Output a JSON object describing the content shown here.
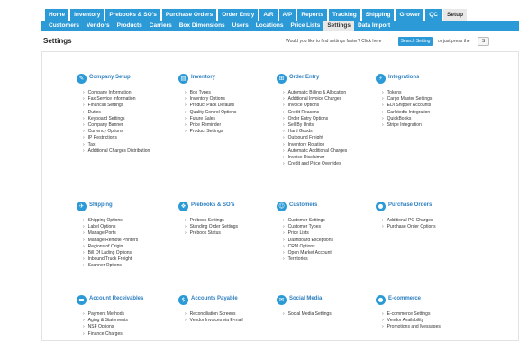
{
  "main_tabs": [
    "Home",
    "Inventory",
    "Prebooks & SO's",
    "Purchase Orders",
    "Order Entry",
    "A/R",
    "A/P",
    "Reports",
    "Tracking",
    "Shipping",
    "Grower",
    "QC",
    "Setup"
  ],
  "active_main_tab": "Setup",
  "sub_tabs": [
    "Customers",
    "Vendors",
    "Products",
    "Carriers",
    "Box Dimensions",
    "Users",
    "Locations",
    "Price Lists",
    "Settings",
    "Data Import"
  ],
  "active_sub_tab": "Settings",
  "header": {
    "title": "Settings",
    "hint": "Would you like to find settings faster? Click here",
    "search_button": "Search Setting",
    "hint2": "or just press the",
    "key": "S"
  },
  "sections": [
    {
      "title": "Company Setup",
      "icon": "wrench-icon",
      "items": [
        "Company Information",
        "Fax Service Information",
        "Financial Settings",
        "Duties",
        "Keyboard Settings",
        "Company Banner",
        "Currency Options",
        "IP Restrictions",
        "Tax",
        "Additional Charges Distribution"
      ]
    },
    {
      "title": "Inventory",
      "icon": "inventory-icon",
      "items": [
        "Box Types",
        "Inventory Options",
        "Product Pack Defaults",
        "Quality Control Options",
        "Future Sales",
        "Price Reminder",
        "Product Settings"
      ]
    },
    {
      "title": "Order Entry",
      "icon": "cart-icon",
      "items": [
        "Automatic Billing & Allocation",
        "Additional Invoice Charges",
        "Invoice Options",
        "Credit Reasons",
        "Order Entry Options",
        "Sell By Units",
        "Hard Goods",
        "Outbound Freight",
        "Inventory Rotation",
        "Automatic Additional Charges",
        "Invoice Disclaimer",
        "Credit and Price Overrides"
      ]
    },
    {
      "title": "Integrations",
      "icon": "plug-icon",
      "items": [
        "Tokens",
        "Cargo Master Settings",
        "EDI Shipper Accounts",
        "Carlstedts Integration",
        "QuickBooks",
        "Stripe Integration"
      ]
    },
    {
      "title": "Shipping",
      "icon": "plane-icon",
      "items": [
        "Shipping Options",
        "Label Options",
        "Manage Ports",
        "Manage Remote Printers",
        "Regions of Origin",
        "Bill Of Lading Options",
        "Inbound Truck Freight",
        "Scanner Options"
      ]
    },
    {
      "title": "Prebooks & SO's",
      "icon": "prebook-icon",
      "items": [
        "Prebook Settings",
        "Standing Order Settings",
        "Prebook Status"
      ]
    },
    {
      "title": "Customers",
      "icon": "customers-icon",
      "items": [
        "Customer Settings",
        "Customer Types",
        "Price Lists",
        "Dashboard Exceptions",
        "CRM Options",
        "Open Market Account",
        "Territories"
      ]
    },
    {
      "title": "Purchase Orders",
      "icon": "purchase-orders-icon",
      "items": [
        "Additional PO Charges",
        "Purchase Order Options"
      ]
    },
    {
      "title": "Account Receivables",
      "icon": "receivables-icon",
      "items": [
        "Payment Methods",
        "Aging & Statements",
        "NSF Options",
        "Finance Charges"
      ]
    },
    {
      "title": "Accounts Payable",
      "icon": "payable-icon",
      "items": [
        "Reconciliation Screens",
        "Vendor Invoices via E-mail"
      ]
    },
    {
      "title": "Social Media",
      "icon": "social-media-icon",
      "items": [
        "Social Media Settings"
      ]
    },
    {
      "title": "E-commerce",
      "icon": "ecommerce-icon",
      "items": [
        "E-commerce Settings",
        "Vendor Availability",
        "Promotions and Messages"
      ]
    }
  ]
}
